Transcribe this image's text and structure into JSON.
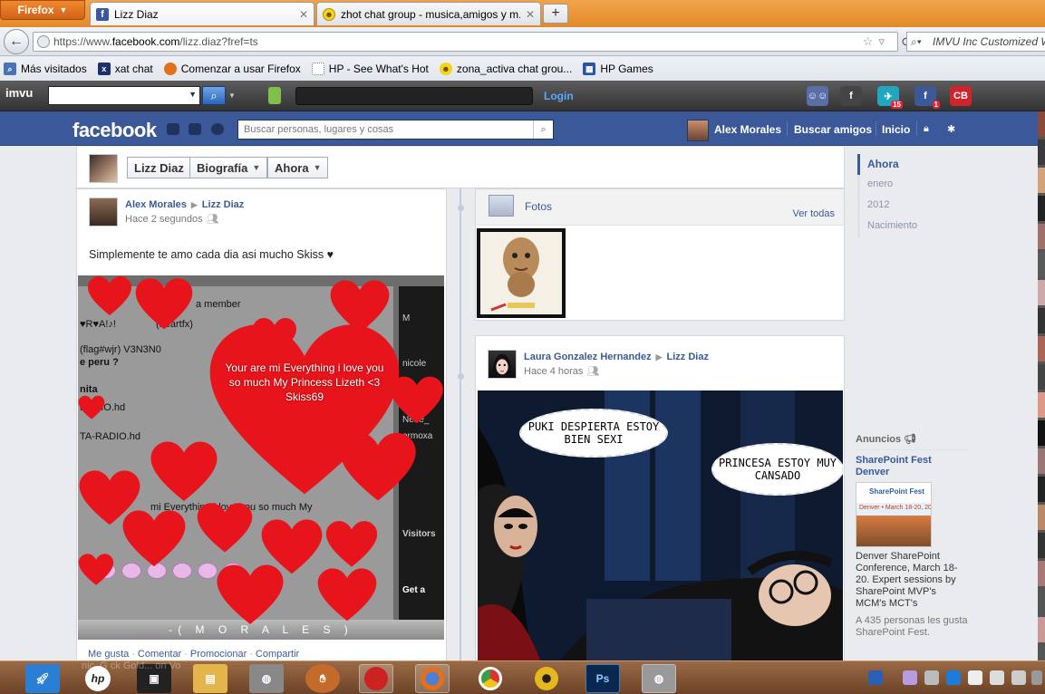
{
  "browser": {
    "menu_button": "Firefox",
    "tabs": [
      {
        "label": "Lizz Diaz",
        "favicon": "facebook-icon",
        "active": true
      },
      {
        "label": "zhot chat group - musica,amigos y m...",
        "favicon": "smiley-icon",
        "active": false
      }
    ],
    "new_tab": "+",
    "url_prefix": "https://www.",
    "url_host": "facebook.com",
    "url_path": "/lizz.diaz?fref=ts",
    "search_engine_text": "IMVU Inc Customized W",
    "bookmarks": [
      {
        "label": "Más visitados",
        "icon": "most-visited-icon",
        "color": "#4a72b8"
      },
      {
        "label": "xat chat",
        "icon": "xat-icon",
        "color": "#1e2f6d"
      },
      {
        "label": "Comenzar a usar Firefox",
        "icon": "firefox-icon",
        "color": "#e46f1d"
      },
      {
        "label": "HP - See What's Hot",
        "icon": "page-icon",
        "color": "#ffffff"
      },
      {
        "label": "zona_activa chat grou...",
        "icon": "smiley-icon",
        "color": "#f5d31b"
      },
      {
        "label": "HP Games",
        "icon": "hp-games-icon",
        "color": "#2753a8"
      }
    ]
  },
  "imvu_toolbar": {
    "logo": "imvu",
    "search_go": "⌕",
    "login_label": "Login",
    "icons": [
      {
        "name": "friends-icon",
        "badge": "",
        "color": "#5a6fa8"
      },
      {
        "name": "imvu-facebook-icon",
        "badge": "",
        "color": "#444"
      },
      {
        "name": "messages-icon",
        "badge": "15",
        "color": "#21a6c2"
      },
      {
        "name": "facebook-notify-icon",
        "badge": "1",
        "color": "#3b5998"
      },
      {
        "name": "cb-icon",
        "badge": "",
        "color": "#d2232a"
      }
    ]
  },
  "facebook": {
    "logo": "facebook",
    "search_placeholder": "Buscar personas, lugares y cosas",
    "user_name": "Alex Morales",
    "find_friends": "Buscar amigos",
    "home": "Inicio",
    "profile_name": "Lizz Diaz",
    "timeline_button": "Biografía",
    "now_button": "Ahora",
    "timeline_nav": [
      {
        "label": "Ahora",
        "active": true
      },
      {
        "label": "enero",
        "active": false
      },
      {
        "label": "2012",
        "active": false
      },
      {
        "label": "Nacimiento",
        "active": false
      }
    ],
    "post1": {
      "author": "Alex Morales",
      "target": "Lizz Diaz",
      "time": "Hace 2 segundos",
      "text": "Simplemente te amo cada dia asi mucho Skiss ♥",
      "image_message": "Your are mi Everything  i love you so much My Princess Lizeth <3 Skiss69",
      "chat_lines": [
        "a member",
        "♥R♥A!♪!",
        "(heartfx)",
        "(flag#wjr)  V3N3N0",
        "e peru ?",
        "nita",
        "RADIO.hd",
        "TA-RADIO.hd",
        "mi Everything  i love you so much My",
        "Visitors",
        "Get a",
        "M",
        "nicole",
        "Nene_",
        "ermoxa"
      ],
      "footer": "-( M O R A L E S )",
      "actions": [
        "Me gusta",
        "Comentar",
        "Promocionar",
        "Compartir"
      ]
    },
    "photos": {
      "title": "Fotos",
      "see_all": "Ver todas"
    },
    "post2": {
      "author": "Laura Gonzalez Hernandez",
      "target": "Lizz Diaz",
      "time": "Hace 4 horas",
      "bubble1": "PUKI DESPIERTA ESTOY BIEN SEXI",
      "bubble2": "PRINCESA ESTOY MUY CANSADO"
    },
    "ads": {
      "heading": "Anuncios",
      "title": "SharePoint Fest Denver",
      "img_logo": "SharePoint Fest",
      "img_dates": "Denver • March 18-20, 2013",
      "description": "Denver SharePoint Conference, March 18-20. Expert sessions by SharePoint MVP's MCM's MCT's",
      "likes": "A 435 personas les gusta SharePoint Fest."
    }
  },
  "taskbar": {
    "ghost_text": "nic, G  ck Gold...  on Vo",
    "apps": [
      {
        "name": "rocket-app-icon",
        "label": "",
        "color": "#2a7fd4"
      },
      {
        "name": "hp-app-icon",
        "label": "hp",
        "color": "#8a5a3a"
      },
      {
        "name": "cursor-app-icon",
        "label": "",
        "color": "#222"
      },
      {
        "name": "explorer-app-icon",
        "label": "",
        "color": "#e3b54a"
      },
      {
        "name": "imvu-app-icon",
        "label": "",
        "color": "#aaa"
      },
      {
        "name": "glove-app-icon",
        "label": "",
        "color": "#c46a2a"
      },
      {
        "name": "media-app-icon",
        "label": "",
        "color": "#c22"
      },
      {
        "name": "firefox-app-icon",
        "label": "",
        "color": "#e46f1d"
      },
      {
        "name": "chrome-app-icon",
        "label": "",
        "color": "#3a9e44"
      },
      {
        "name": "disc-app-icon",
        "label": "",
        "color": "#e5b820"
      },
      {
        "name": "photoshop-app-icon",
        "label": "Ps",
        "color": "#0a2750"
      },
      {
        "name": "imvu2-app-icon",
        "label": "",
        "color": "#aaa"
      }
    ]
  }
}
